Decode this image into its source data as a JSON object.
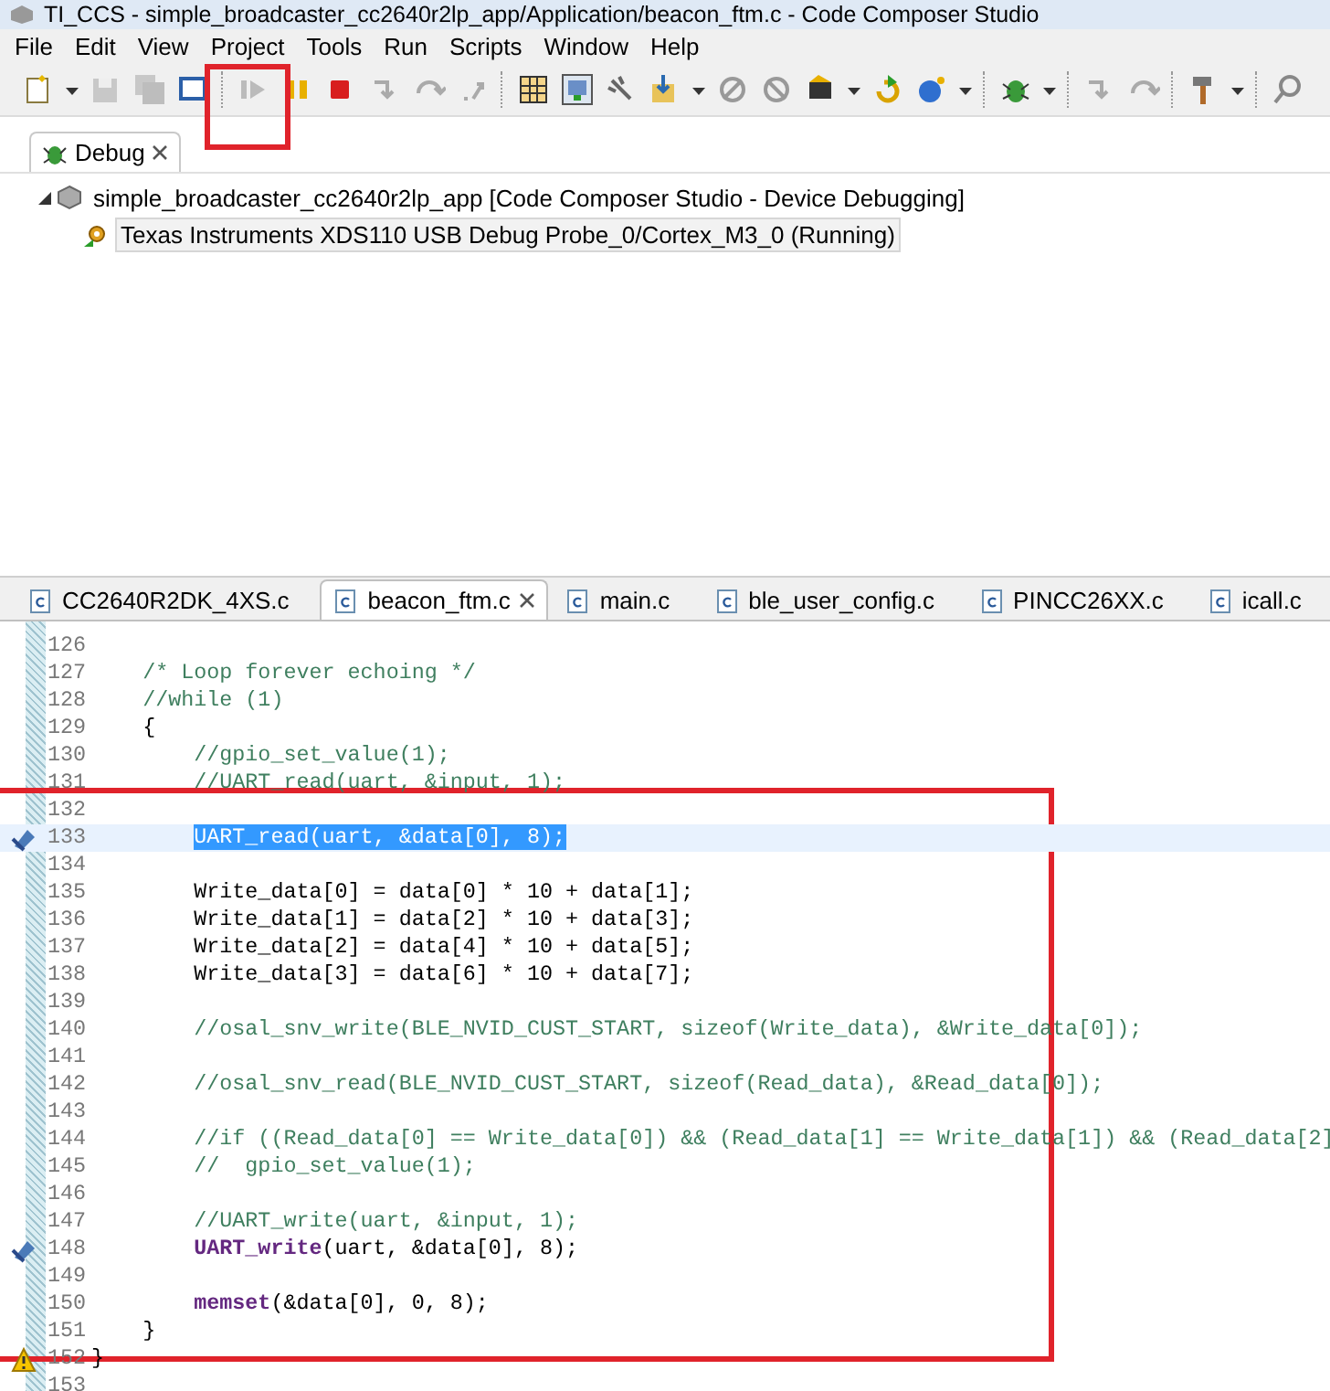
{
  "window": {
    "title": "TI_CCS - simple_broadcaster_cc2640r2lp_app/Application/beacon_ftm.c - Code Composer Studio"
  },
  "menu": [
    "File",
    "Edit",
    "View",
    "Project",
    "Tools",
    "Run",
    "Scripts",
    "Window",
    "Help"
  ],
  "debug_view": {
    "tab": "Debug",
    "tree": [
      {
        "label": "simple_broadcaster_cc2640r2lp_app [Code Composer Studio - Device Debugging]",
        "expanded": true,
        "selected": false,
        "children": [
          {
            "label": "Texas Instruments XDS110 USB Debug Probe_0/Cortex_M3_0 (Running)",
            "selected": true
          }
        ]
      }
    ]
  },
  "editor": {
    "tabs": [
      {
        "label": "CC2640R2DK_4XS.c",
        "selected": false
      },
      {
        "label": "beacon_ftm.c",
        "selected": true
      },
      {
        "label": "main.c",
        "selected": false
      },
      {
        "label": "ble_user_config.c",
        "selected": false
      },
      {
        "label": "PINCC26XX.c",
        "selected": false
      },
      {
        "label": "icall.c",
        "selected": false
      }
    ],
    "lines": [
      {
        "number": "126",
        "breakpoint": false,
        "warning": false,
        "selected": false
      },
      {
        "number": "127",
        "breakpoint": false,
        "warning": false,
        "selected": false,
        "segments": [
          {
            "text": "    /* Loop forever echoing */",
            "kind": "comment"
          }
        ]
      },
      {
        "number": "128",
        "breakpoint": false,
        "warning": false,
        "selected": false,
        "segments": [
          {
            "text": "    //while (1)",
            "kind": "comment"
          }
        ]
      },
      {
        "number": "129",
        "breakpoint": false,
        "warning": false,
        "selected": false,
        "segments": [
          {
            "text": "    {",
            "kind": "plain"
          }
        ]
      },
      {
        "number": "130",
        "breakpoint": false,
        "warning": false,
        "selected": false,
        "segments": [
          {
            "text": "        //gpio_set_value(1);",
            "kind": "comment"
          }
        ]
      },
      {
        "number": "131",
        "breakpoint": false,
        "warning": false,
        "selected": false,
        "segments": [
          {
            "text": "        //UART_read(uart, &input, 1);",
            "kind": "comment"
          }
        ]
      },
      {
        "number": "132",
        "breakpoint": false,
        "warning": false,
        "selected": false
      },
      {
        "number": "133",
        "breakpoint": true,
        "warning": false,
        "selected": true,
        "segments": [
          {
            "text": "        UART_read(uart, &data[0], 8);",
            "kind": "plain"
          }
        ]
      },
      {
        "number": "134",
        "breakpoint": false,
        "warning": false,
        "selected": false
      },
      {
        "number": "135",
        "breakpoint": false,
        "warning": false,
        "selected": false,
        "segments": [
          {
            "text": "        Write_data[0] = data[0] * 10 + data[1];",
            "kind": "plain"
          }
        ]
      },
      {
        "number": "136",
        "breakpoint": false,
        "warning": false,
        "selected": false,
        "segments": [
          {
            "text": "        Write_data[1] = data[2] * 10 + data[3];",
            "kind": "plain"
          }
        ]
      },
      {
        "number": "137",
        "breakpoint": false,
        "warning": false,
        "selected": false,
        "segments": [
          {
            "text": "        Write_data[2] = data[4] * 10 + data[5];",
            "kind": "plain"
          }
        ]
      },
      {
        "number": "138",
        "breakpoint": false,
        "warning": false,
        "selected": false,
        "segments": [
          {
            "text": "        Write_data[3] = data[6] * 10 + data[7];",
            "kind": "plain"
          }
        ]
      },
      {
        "number": "139",
        "breakpoint": false,
        "warning": false,
        "selected": false
      },
      {
        "number": "140",
        "breakpoint": false,
        "warning": false,
        "selected": false,
        "segments": [
          {
            "text": "        //osal_snv_write(BLE_NVID_CUST_START, sizeof(Write_data), &Write_data[0]);",
            "kind": "comment"
          }
        ]
      },
      {
        "number": "141",
        "breakpoint": false,
        "warning": false,
        "selected": false
      },
      {
        "number": "142",
        "breakpoint": false,
        "warning": false,
        "selected": false,
        "segments": [
          {
            "text": "        //osal_snv_read(BLE_NVID_CUST_START, sizeof(Read_data), &Read_data[0]);",
            "kind": "comment"
          }
        ]
      },
      {
        "number": "143",
        "breakpoint": false,
        "warning": false,
        "selected": false
      },
      {
        "number": "144",
        "breakpoint": false,
        "warning": false,
        "selected": false,
        "segments": [
          {
            "text": "        //if ((Read_data[0] == Write_data[0]) && (Read_data[1] == Write_data[1]) && (Read_data[2]",
            "kind": "comment"
          }
        ]
      },
      {
        "number": "145",
        "breakpoint": false,
        "warning": false,
        "selected": false,
        "segments": [
          {
            "text": "        //  gpio_set_value(1);",
            "kind": "comment"
          }
        ]
      },
      {
        "number": "146",
        "breakpoint": false,
        "warning": false,
        "selected": false
      },
      {
        "number": "147",
        "breakpoint": false,
        "warning": false,
        "selected": false,
        "segments": [
          {
            "text": "        //UART_write(uart, &input, 1);",
            "kind": "comment"
          }
        ]
      },
      {
        "number": "148",
        "breakpoint": true,
        "warning": false,
        "selected": false,
        "segments": [
          {
            "text": "        UART_write",
            "kind": "function"
          },
          {
            "text": "(uart, &data[0], 8);",
            "kind": "plain"
          }
        ]
      },
      {
        "number": "149",
        "breakpoint": false,
        "warning": false,
        "selected": false
      },
      {
        "number": "150",
        "breakpoint": false,
        "warning": false,
        "selected": false,
        "segments": [
          {
            "text": "        memset",
            "kind": "function"
          },
          {
            "text": "(&data[0], 0, 8);",
            "kind": "plain"
          }
        ]
      },
      {
        "number": "151",
        "breakpoint": false,
        "warning": false,
        "selected": false,
        "segments": [
          {
            "text": "    }",
            "kind": "plain"
          }
        ]
      },
      {
        "number": "152",
        "breakpoint": false,
        "warning": true,
        "selected": false,
        "segments": [
          {
            "text": "}",
            "kind": "plain"
          }
        ]
      },
      {
        "number": "153",
        "breakpoint": false,
        "warning": false,
        "selected": false
      }
    ]
  }
}
